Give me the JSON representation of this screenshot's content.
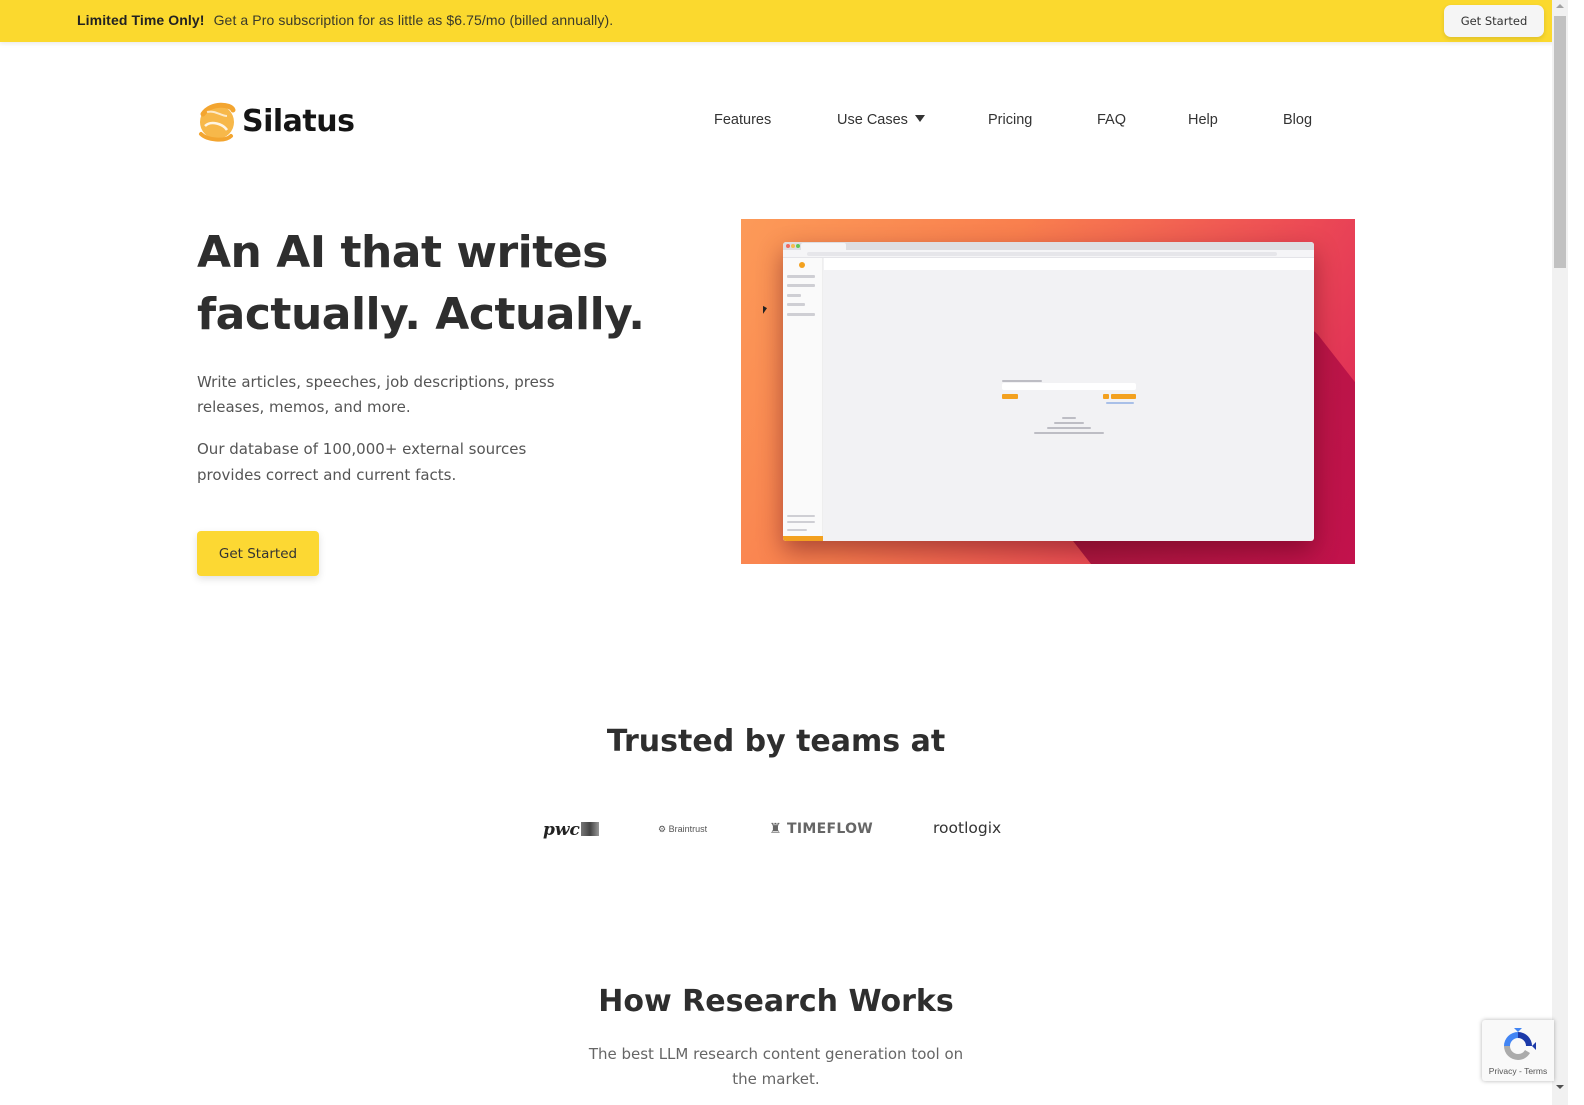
{
  "promo": {
    "highlight": "Limited Time Only!",
    "message": "Get a Pro subscription for as little as $6.75/mo (billed annually).",
    "cta_label": "Get Started"
  },
  "header": {
    "brand_name": "Silatus",
    "nav": [
      {
        "label": "Features"
      },
      {
        "label": "Use Cases",
        "has_dropdown": true
      },
      {
        "label": "Pricing"
      },
      {
        "label": "FAQ"
      },
      {
        "label": "Help"
      },
      {
        "label": "Blog"
      }
    ]
  },
  "hero": {
    "title": "An AI that writes factually. Actually.",
    "paragraph_1": "Write articles, speeches, job descriptions, press releases, memos, and more.",
    "paragraph_2": "Our database of 100,000+ external sources provides correct and current facts.",
    "cta_label": "Get Started",
    "image_alt": "Silatus app screenshot"
  },
  "trusted": {
    "heading": "Trusted by teams at",
    "logos": [
      "pwc",
      "Braintrust",
      "TIMEFLOW",
      "rootlogix"
    ]
  },
  "how_it_works": {
    "heading": "How Research Works",
    "subtitle": "The best LLM research content generation tool on the market."
  },
  "recaptcha": {
    "links": "Privacy - Terms"
  },
  "colors": {
    "brand_yellow": "#fbd92e",
    "button_yellow": "#fcd833",
    "logo_orange": "#f5b042",
    "heading_text": "#2e2e2e",
    "body_text": "#555555"
  }
}
